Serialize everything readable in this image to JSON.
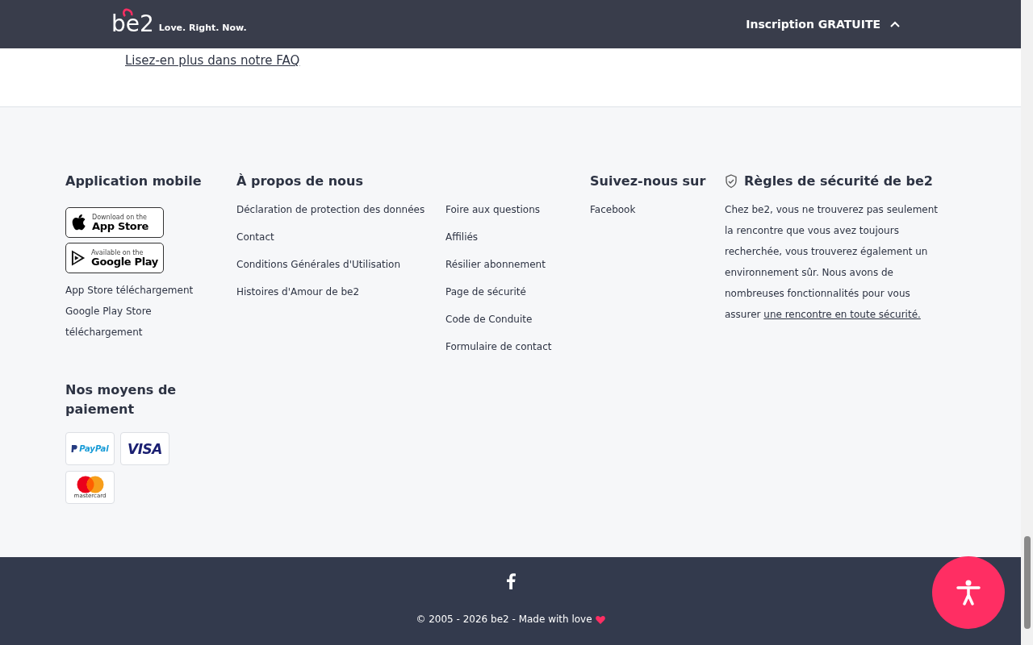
{
  "page_content": {
    "faq_link": "Lisez-en plus dans notre FAQ"
  },
  "header": {
    "logo": "be2",
    "tagline": "Love. Right. Now.",
    "signup": "Inscription GRATUITE"
  },
  "footer": {
    "mobile": {
      "title": "Application mobile",
      "badges": [
        {
          "kind": "apple",
          "small": "Download on the",
          "big": "App Store"
        },
        {
          "kind": "google",
          "small": "Available on the",
          "big": "Google Play"
        }
      ],
      "links": [
        "App Store téléchargement",
        "Google Play Store téléchargement"
      ]
    },
    "payment": {
      "title": "Nos moyens de paiement",
      "methods": [
        {
          "kind": "paypal",
          "label": "PayPal"
        },
        {
          "kind": "visa",
          "label": "VISA"
        },
        {
          "kind": "mastercard",
          "label": "mastercard"
        }
      ]
    },
    "about": {
      "title": "À propos de nous",
      "column_1": [
        "Déclaration de protection des données",
        "Contact",
        "Conditions Générales d'Utilisation",
        "Histoires d'Amour de be2"
      ],
      "column_2": [
        "Foire aux questions",
        "Affiliés",
        "Résilier abonnement",
        "Page de sécurité",
        "Code de Conduite",
        "Formulaire de contact"
      ]
    },
    "follow": {
      "title": "Suivez-nous sur",
      "links": [
        "Facebook"
      ]
    },
    "safety": {
      "title": "Règles de sécurité de be2",
      "text": "Chez be2, vous ne trouverez pas seulement la rencontre que vous avez toujours recherchée, vous trouverez également un environnement sûr. Nous avons de nombreuses fonctionnalités pour vous assurer",
      "link": "une rencontre en toute sécurité."
    }
  },
  "bottom_bar": {
    "copyright": "© 2005 - 2026 be2 - Made with love"
  }
}
